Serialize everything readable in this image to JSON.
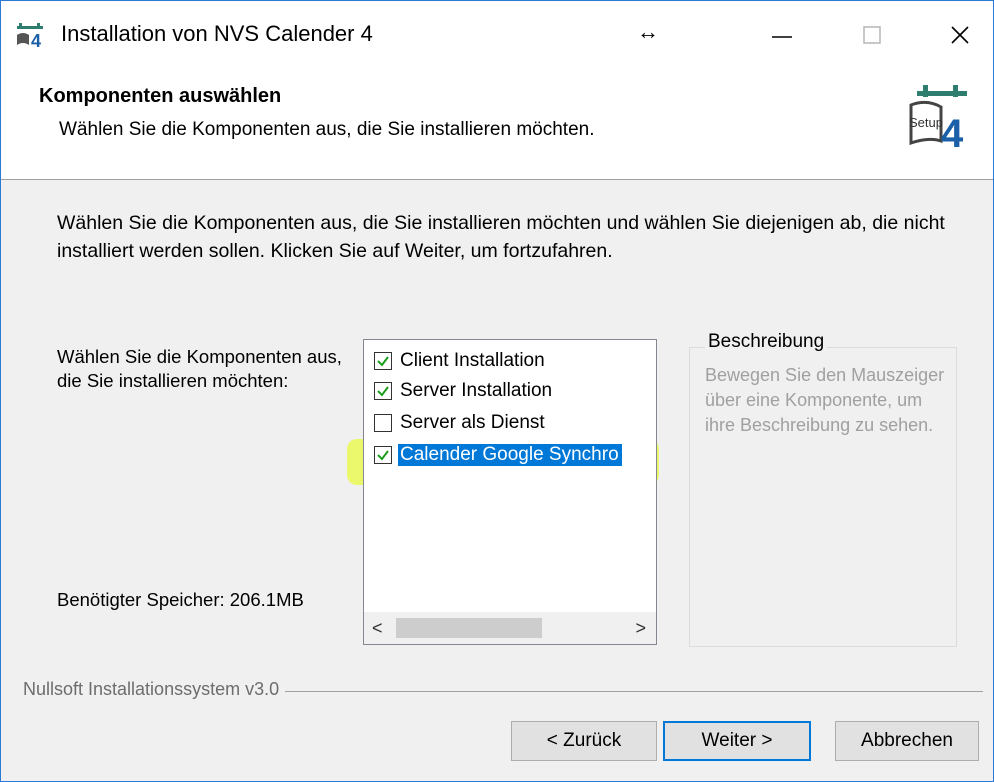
{
  "window": {
    "title": "Installation von NVS Calender 4",
    "resize_glyph": "↔",
    "controls": [
      "minimize-icon",
      "maximize-icon",
      "close-icon"
    ]
  },
  "header": {
    "title": "Komponenten auswählen",
    "subtitle": "Wählen Sie die Komponenten aus, die Sie installieren möchten.",
    "logo_text": "Setup",
    "logo_number": "4"
  },
  "main": {
    "intro": "Wählen Sie die Komponenten aus, die Sie installieren möchten und wählen Sie diejenigen ab, die nicht installiert werden sollen. Klicken Sie auf Weiter, um fortzufahren.",
    "select_label": "Wählen Sie die Komponenten aus, die Sie installieren möchten:",
    "space_required": "Benötigter Speicher: 206.1MB",
    "components": [
      {
        "label": "Client Installation",
        "checked": true,
        "selected": false
      },
      {
        "label": "Server Installation",
        "checked": true,
        "selected": false
      },
      {
        "label": "Server als Dienst",
        "checked": false,
        "selected": false
      },
      {
        "label": "Calender Google Synchro",
        "checked": true,
        "selected": true
      }
    ],
    "scroll_left": "<",
    "scroll_right": ">",
    "description_title": "Beschreibung",
    "description_text": "Bewegen Sie den Mauszeiger über eine Komponente, um ihre Beschreibung zu sehen."
  },
  "footer": {
    "branding": "Nullsoft Installationssystem v3.0",
    "back_label": "< Zurück",
    "next_label": "Weiter >",
    "cancel_label": "Abbrechen"
  },
  "colors": {
    "accent": "#0078d7",
    "checkmark": "#1a9e1a",
    "highlight": "#e8ff00"
  }
}
